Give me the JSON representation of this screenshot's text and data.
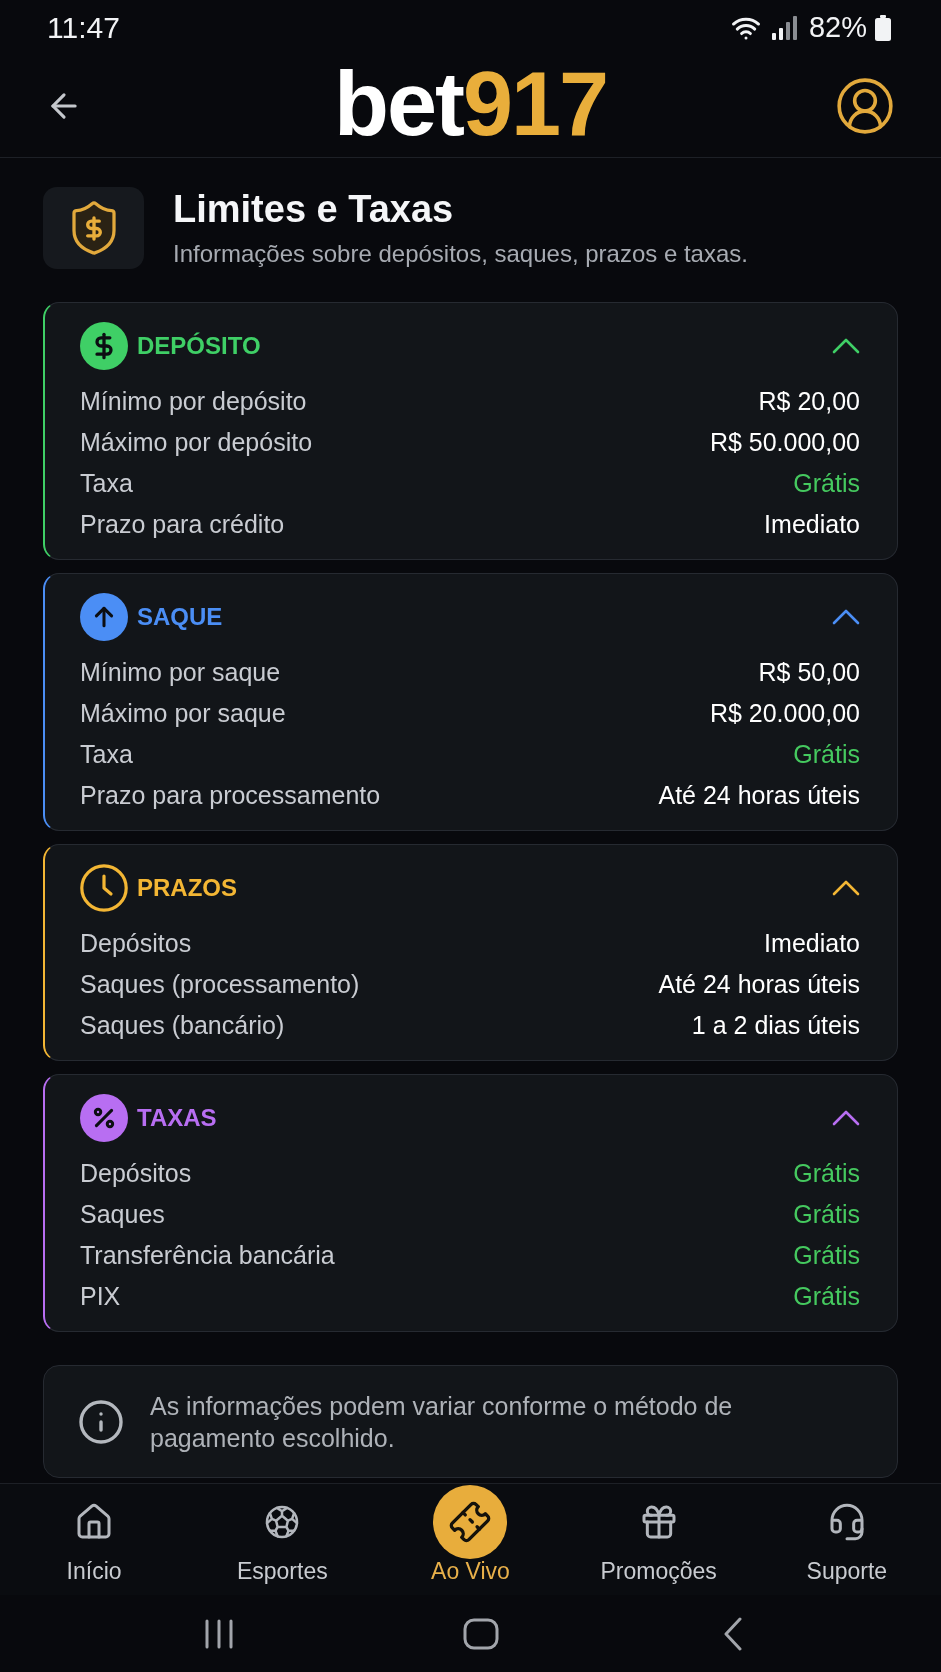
{
  "status_bar": {
    "time": "11:47",
    "battery": "82%"
  },
  "header": {
    "logo": {
      "text": "bet",
      "accent": "917"
    }
  },
  "page": {
    "title": "Limites e Taxas",
    "subtitle": "Informações sobre depósitos, saques, prazos e taxas."
  },
  "sections": [
    {
      "title": "DEPÓSITO",
      "color": "#3fcf66",
      "expanded": true,
      "rows": [
        {
          "label": "Mínimo por depósito",
          "value": "R$ 20,00",
          "color": "#ffffff"
        },
        {
          "label": "Máximo por depósito",
          "value": "R$ 50.000,00",
          "color": "#ffffff"
        },
        {
          "label": "Taxa",
          "value": "Grátis",
          "color": "#45c95f"
        },
        {
          "label": "Prazo para crédito",
          "value": "Imediato",
          "color": "#ffffff"
        }
      ]
    },
    {
      "title": "SAQUE",
      "color": "#4b8ef5",
      "expanded": true,
      "rows": [
        {
          "label": "Mínimo por saque",
          "value": "R$ 50,00",
          "color": "#ffffff"
        },
        {
          "label": "Máximo por saque",
          "value": "R$ 20.000,00",
          "color": "#ffffff"
        },
        {
          "label": "Taxa",
          "value": "Grátis",
          "color": "#45c95f"
        },
        {
          "label": "Prazo para processamento",
          "value": "Até 24 horas úteis",
          "color": "#ffffff"
        }
      ]
    },
    {
      "title": "PRAZOS",
      "color": "#f3b634",
      "expanded": true,
      "rows": [
        {
          "label": "Depósitos",
          "value": "Imediato",
          "color": "#ffffff"
        },
        {
          "label": "Saques (processamento)",
          "value": "Até 24 horas úteis",
          "color": "#ffffff"
        },
        {
          "label": "Saques (bancário)",
          "value": "1 a 2 dias úteis",
          "color": "#ffffff"
        }
      ]
    },
    {
      "title": "TAXAS",
      "color": "#b86ef2",
      "expanded": true,
      "rows": [
        {
          "label": "Depósitos",
          "value": "Grátis",
          "color": "#45c95f"
        },
        {
          "label": "Saques",
          "value": "Grátis",
          "color": "#45c95f"
        },
        {
          "label": "Transferência bancária",
          "value": "Grátis",
          "color": "#45c95f"
        },
        {
          "label": "PIX",
          "value": "Grátis",
          "color": "#45c95f"
        }
      ]
    }
  ],
  "note": {
    "text": "As informações podem variar conforme o método de pagamento escolhido."
  },
  "nav": [
    {
      "label": "Início",
      "selected": false
    },
    {
      "label": "Esportes",
      "selected": false
    },
    {
      "label": "Ao Vivo",
      "selected": true
    },
    {
      "label": "Promoções",
      "selected": false
    },
    {
      "label": "Suporte",
      "selected": false
    }
  ]
}
